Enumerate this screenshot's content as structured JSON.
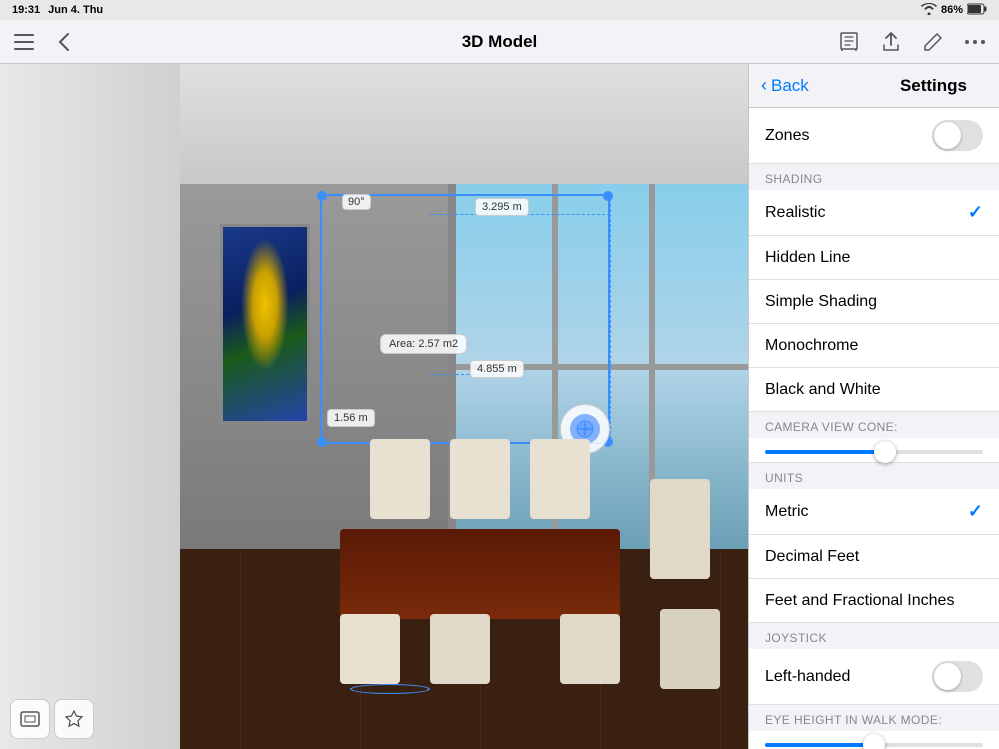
{
  "statusBar": {
    "time": "19:31",
    "date": "Jun 4. Thu",
    "wifi": "wifi-icon",
    "battery": "86%",
    "batteryIcon": "battery-icon"
  },
  "topNav": {
    "title": "3D Model",
    "backIcon": "‹",
    "menuIcon": "≡",
    "bookIcon": "📖",
    "shareIcon": "↑",
    "pencilIcon": "✏",
    "moreIcon": "•••"
  },
  "measureLabels": {
    "width": "3.295 m",
    "height": "4.855 m",
    "side": "1.56 m",
    "area": "Area: 2.57 m2",
    "angle": "90°"
  },
  "settings": {
    "backLabel": "Back",
    "title": "Settings",
    "zones": {
      "label": "Zones",
      "enabled": false
    },
    "shading": {
      "sectionLabel": "SHADING",
      "items": [
        {
          "label": "Realistic",
          "selected": true
        },
        {
          "label": "Hidden Line",
          "selected": false
        },
        {
          "label": "Simple Shading",
          "selected": false
        },
        {
          "label": "Monochrome",
          "selected": false
        },
        {
          "label": "Black and White",
          "selected": false
        }
      ]
    },
    "cameraViewCone": {
      "sectionLabel": "CAMERA VIEW CONE:",
      "fillPercent": 55
    },
    "units": {
      "sectionLabel": "UNITS",
      "items": [
        {
          "label": "Metric",
          "selected": true
        },
        {
          "label": "Decimal Feet",
          "selected": false
        },
        {
          "label": "Feet and Fractional Inches",
          "selected": false
        }
      ]
    },
    "joystick": {
      "sectionLabel": "JOYSTICK",
      "leftHanded": {
        "label": "Left-handed",
        "enabled": false
      }
    },
    "eyeHeight": {
      "sectionLabel": "EYE HEIGHT IN WALK MODE:",
      "fillPercent": 50
    }
  },
  "toolbar": {
    "squareIcon": "⬜",
    "shapeIcon": "⬡"
  }
}
